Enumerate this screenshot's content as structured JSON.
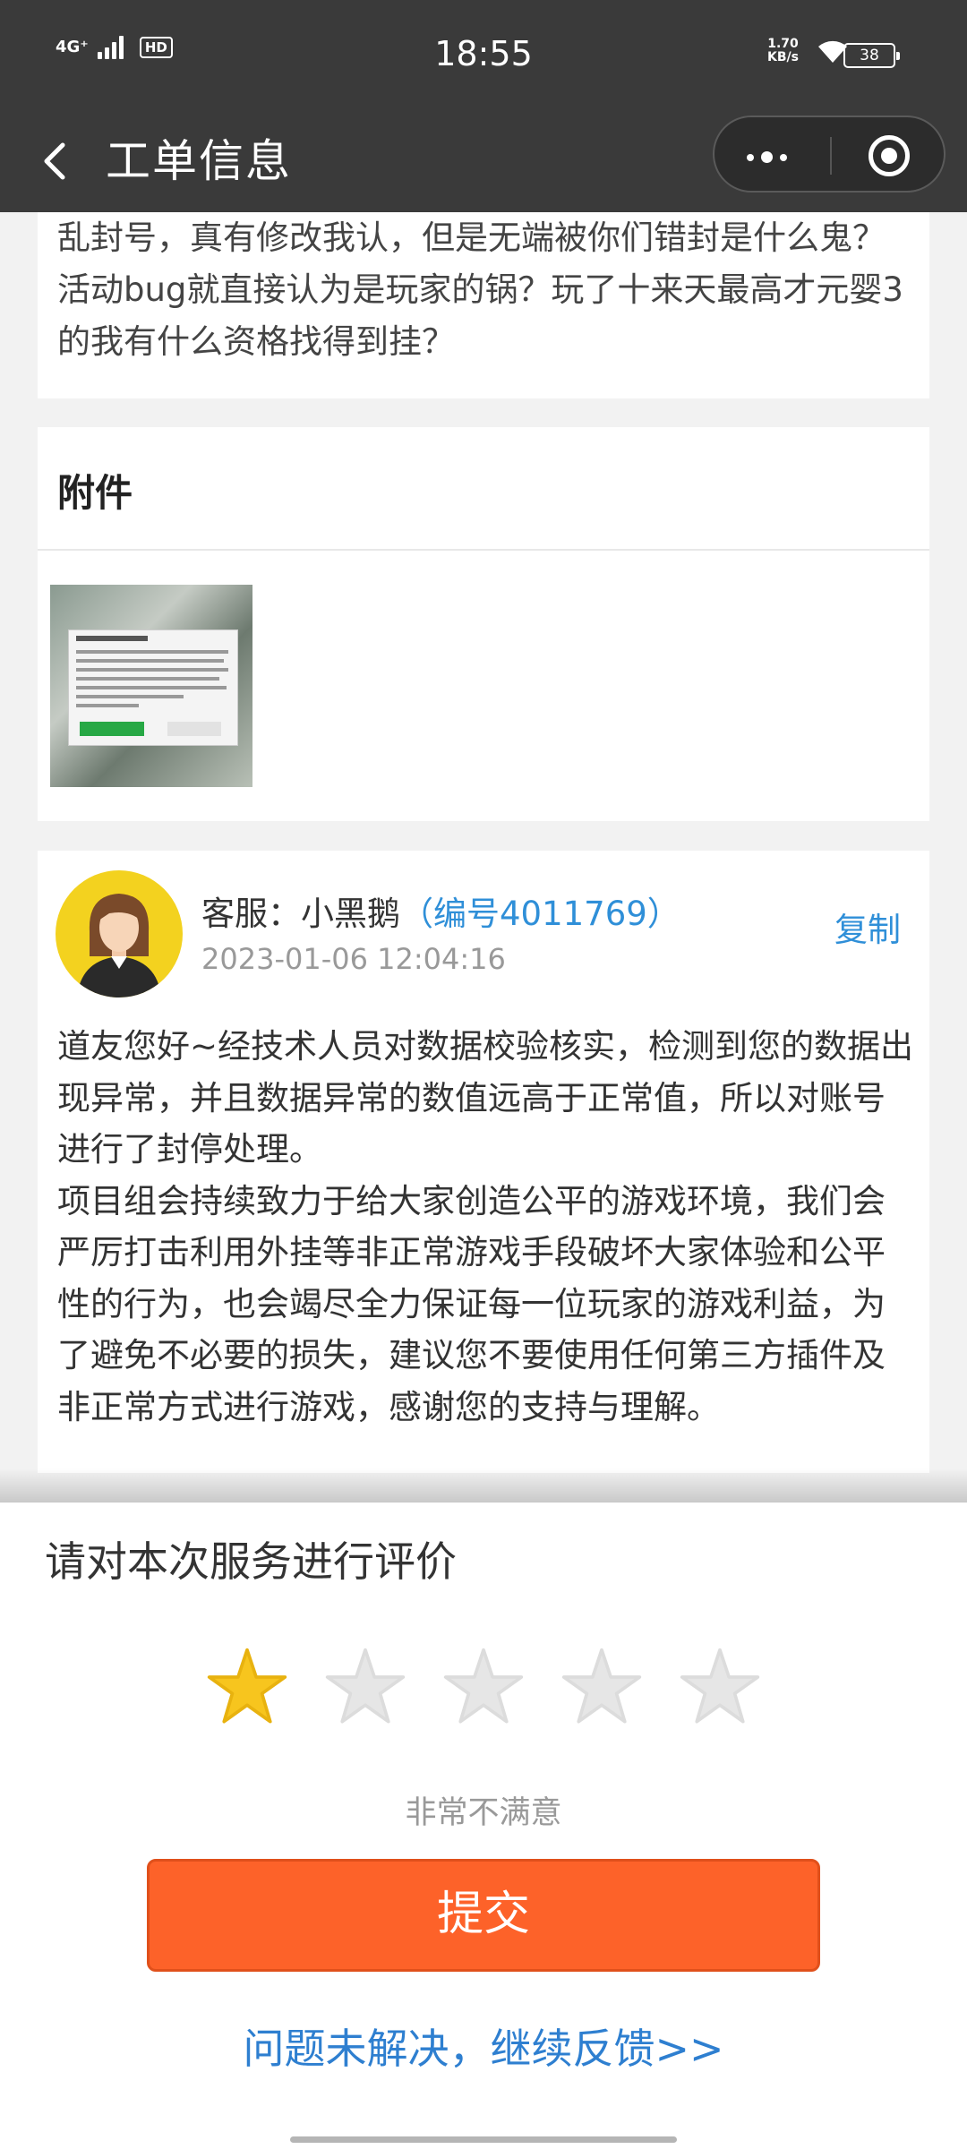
{
  "status_bar": {
    "network": "4G⁺",
    "hd_badge": "HD",
    "time": "18:55",
    "speed_value": "1.70",
    "speed_unit": "KB/s",
    "battery": "38"
  },
  "nav": {
    "title": "工单信息"
  },
  "description": {
    "text": "乱封号，真有修改我认，但是无端被你们错封是什么鬼？活动bug就直接认为是玩家的锅？玩了十来天最高才元婴3的我有什么资格找得到挂？"
  },
  "attachment": {
    "title": "附件"
  },
  "reply": {
    "agent_label": "客服：小黑鹅",
    "agent_id": "（编号4011769）",
    "time": "2023-01-06 12:04:16",
    "copy_label": "复制",
    "paragraph1": "道友您好~经技术人员对数据校验核实，检测到您的数据出现异常，并且数据异常的数值远高于正常值，所以对账号进行了封停处理。",
    "paragraph2": "项目组会持续致力于给大家创造公平的游戏环境，我们会严厉打击利用外挂等非正常游戏手段破坏大家体验和公平性的行为，也会竭尽全力保证每一位玩家的游戏利益，为了避免不必要的损失，建议您不要使用任何第三方插件及非正常方式进行游戏，感谢您的支持与理解。"
  },
  "rating": {
    "title": "请对本次服务进行评价",
    "stars_total": 5,
    "stars_selected": 1,
    "star_active_color": "#f7c51e",
    "star_inactive_color": "#e6e6e6",
    "label": "非常不满意",
    "submit_label": "提交",
    "submit_color": "#fd6229",
    "continue_label": "问题未解决，继续反馈>>"
  }
}
